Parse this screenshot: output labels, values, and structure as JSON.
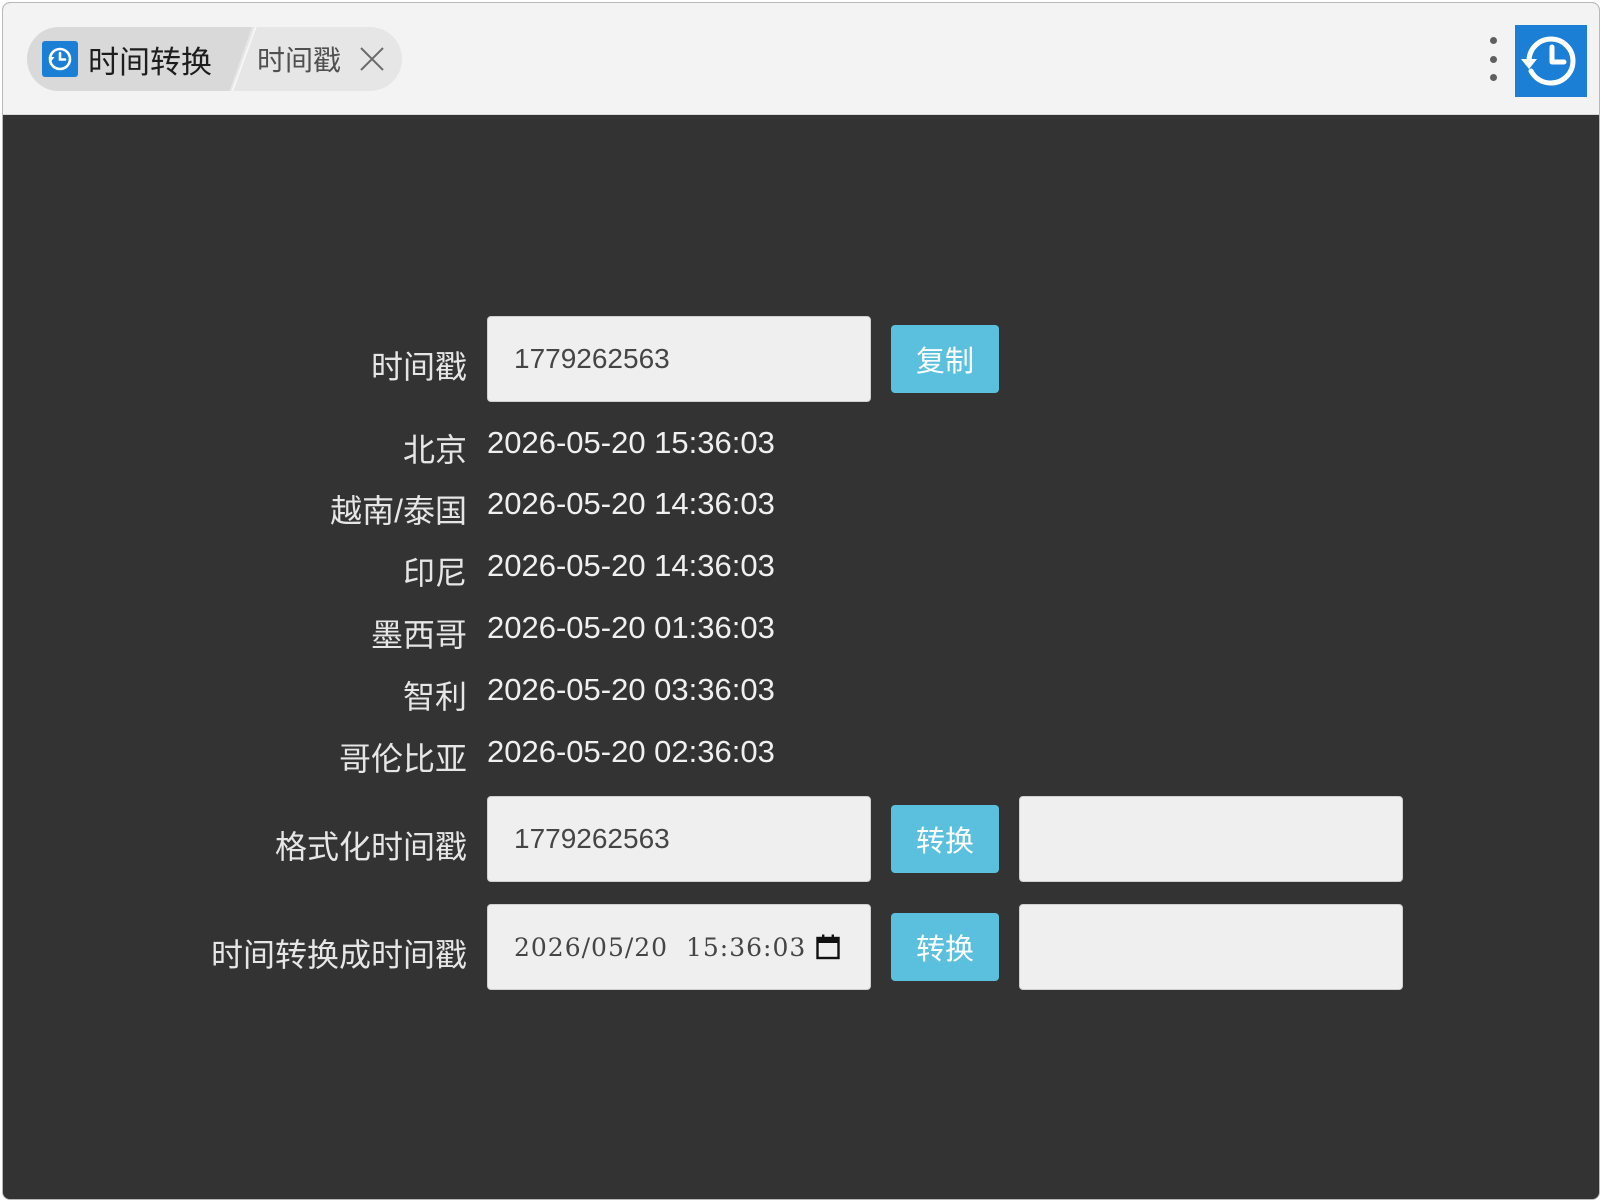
{
  "tabs": {
    "active_title": "时间转换",
    "second_title": "时间戳"
  },
  "colors": {
    "accent": "#1b7fd5",
    "button": "#5bc0de",
    "background": "#333333"
  },
  "icons": {
    "tab_icon": "clock-refresh-icon",
    "close": "close-icon",
    "menu": "more-vertical-icon",
    "logo": "clock-refresh-icon"
  },
  "timestamp": {
    "label": "时间戳",
    "value": "1779262563",
    "copy_label": "复制"
  },
  "zones": [
    {
      "name": "北京",
      "time": "2026-05-20 15:36:03"
    },
    {
      "name": "越南/泰国",
      "time": "2026-05-20 14:36:03"
    },
    {
      "name": "印尼",
      "time": "2026-05-20 14:36:03"
    },
    {
      "name": "墨西哥",
      "time": "2026-05-20 01:36:03"
    },
    {
      "name": "智利",
      "time": "2026-05-20 03:36:03"
    },
    {
      "name": "哥伦比亚",
      "time": "2026-05-20 02:36:03"
    }
  ],
  "format_timestamp": {
    "label": "格式化时间戳",
    "value": "1779262563",
    "button_label": "转换",
    "result": ""
  },
  "time_to_timestamp": {
    "label": "时间转换成时间戳",
    "value": "2026/05/20  15:36:03",
    "button_label": "转换",
    "result": ""
  }
}
